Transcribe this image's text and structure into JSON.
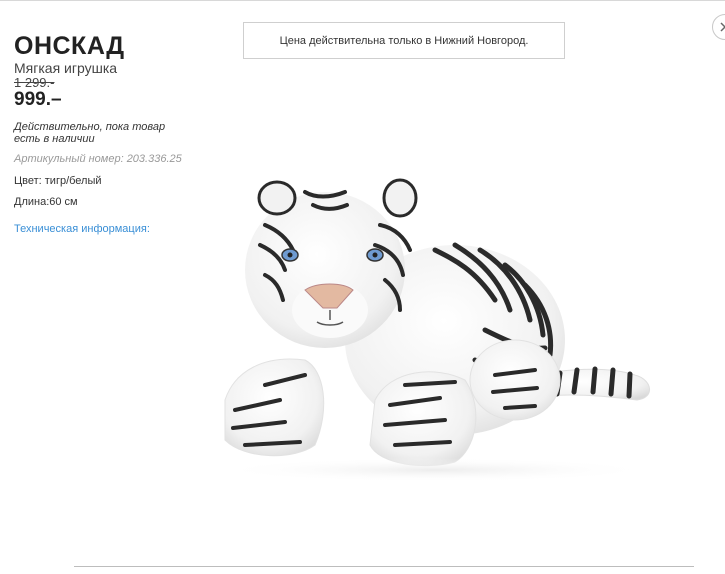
{
  "product": {
    "name": "ОНСКАД",
    "type": "Мягкая игрушка",
    "old_price": "1 299.-",
    "price": "999.–",
    "availability": "Действительно, пока товар есть в наличии",
    "article_label": "Артикульный номер:",
    "article_number": "203.336.25",
    "color": "Цвет: тигр/белый",
    "length": "Длина:60 см",
    "tech_link": "Техническая информация:"
  },
  "notice": "Цена действительна только в Нижний Новгород.",
  "icons": {
    "close": "close-icon"
  },
  "colors": {
    "link": "#3a8fd6",
    "muted": "#999999",
    "text": "#333333"
  }
}
